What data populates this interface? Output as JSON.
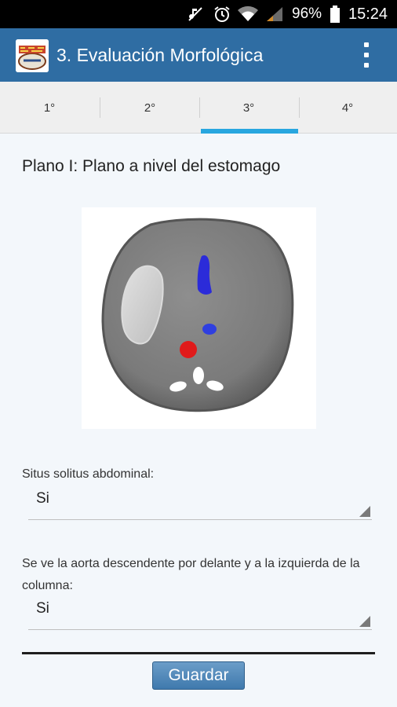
{
  "status_bar": {
    "battery": "96%",
    "time": "15:24"
  },
  "header": {
    "title": "3. Evaluación Morfológica",
    "logo_text": "Fetal Test"
  },
  "tabs": [
    {
      "label": "1°",
      "active": false
    },
    {
      "label": "2°",
      "active": false
    },
    {
      "label": "3°",
      "active": true
    },
    {
      "label": "4°",
      "active": false
    }
  ],
  "main": {
    "plane_title": "Plano I: Plano a nivel del estomago",
    "questions": [
      {
        "label": "Situs solitus abdominal:",
        "value": "Si"
      },
      {
        "label": "Se ve la aorta descendente por delante y a la izquierda de la columna:",
        "value": "Si"
      }
    ],
    "save_label": "Guardar"
  },
  "colors": {
    "action_bar": "#2f6da3",
    "tab_indicator": "#28a6df",
    "status_bar": "#000000",
    "button": "#4a84b8"
  },
  "icons": [
    "no-sound-icon",
    "alarm-icon",
    "wifi-icon",
    "signal-icon",
    "battery-icon",
    "overflow-menu-icon",
    "dropdown-arrow-icon"
  ]
}
